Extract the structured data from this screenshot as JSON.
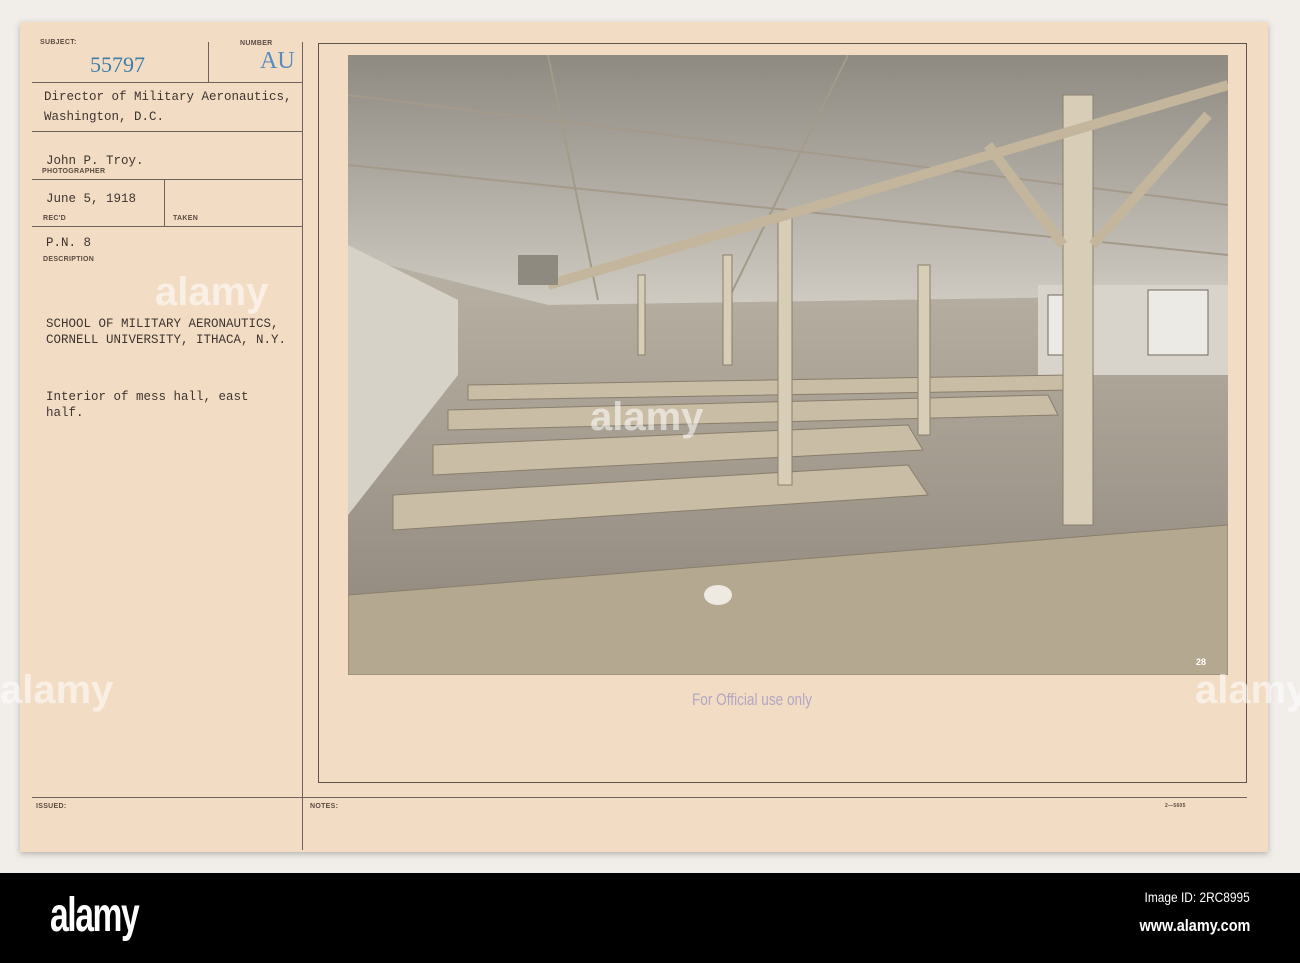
{
  "card": {
    "subject_label": "SUBJECT:",
    "subject_number": "55797",
    "number_label": "NUMBER",
    "number_value": "AU",
    "from_line1": "Director of Military Aeronautics,",
    "from_line2": "Washington, D.C.",
    "photographer": "John P. Troy.",
    "photographer_label": "PHOTOGRAPHER",
    "received_date": "June 5, 1918",
    "received_label": "REC'D",
    "taken_label": "TAKEN",
    "pn": "P.N. 8",
    "description_label": "DESCRIPTION",
    "description_line1": "SCHOOL OF MILITARY AERONAUTICS,",
    "description_line2": "CORNELL UNIVERSITY, ITHACA, N.Y.",
    "caption_line1": "Interior of mess hall, east",
    "caption_line2": "half.",
    "photo_number": "28",
    "stamp": "For Official use only",
    "issued_label": "ISSUED:",
    "notes_label": "NOTES:",
    "form_code": "2—5605"
  },
  "watermark": {
    "logo": "alamy",
    "image_id": "Image ID: 2RC8995",
    "url": "www.alamy.com"
  }
}
